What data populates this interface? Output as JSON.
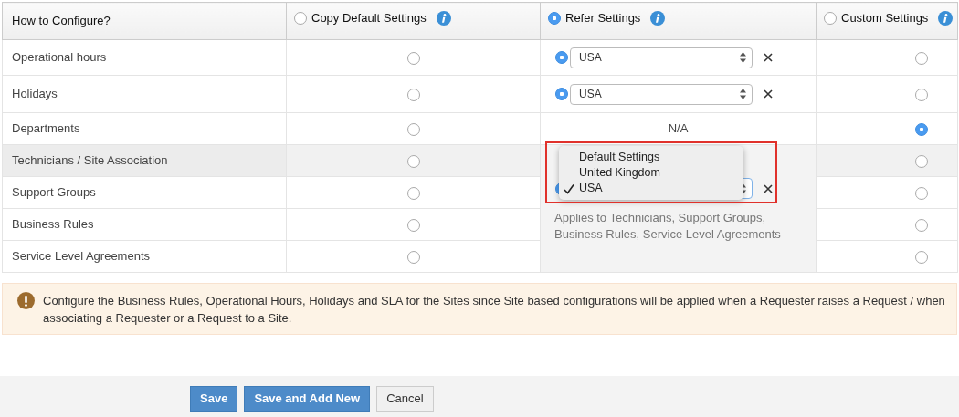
{
  "header": {
    "title": "How to Configure?",
    "columns": [
      {
        "label": "Copy Default Settings",
        "selected": false
      },
      {
        "label": "Refer Settings",
        "selected": true
      },
      {
        "label": "Custom Settings",
        "selected": false
      }
    ]
  },
  "rows": [
    {
      "label": "Operational hours",
      "highlighted": false,
      "copy_selected": false,
      "refer": {
        "kind": "select",
        "selected": true,
        "value": "USA"
      },
      "custom_selected": false
    },
    {
      "label": "Holidays",
      "highlighted": false,
      "copy_selected": false,
      "refer": {
        "kind": "select",
        "selected": true,
        "value": "USA"
      },
      "custom_selected": false
    },
    {
      "label": "Departments",
      "highlighted": false,
      "copy_selected": false,
      "refer": {
        "kind": "text",
        "text": "N/A"
      },
      "custom_selected": true
    },
    {
      "label": "Technicians / Site Association",
      "highlighted": true,
      "copy_selected": false,
      "custom_selected": false
    },
    {
      "label": "Support Groups",
      "highlighted": false,
      "copy_selected": false,
      "custom_selected": false
    },
    {
      "label": "Business Rules",
      "highlighted": false,
      "copy_selected": false,
      "custom_selected": false
    },
    {
      "label": "Service Level Agreements",
      "highlighted": false,
      "copy_selected": false,
      "custom_selected": false
    }
  ],
  "refer_group": {
    "selected": true,
    "menu": [
      {
        "label": "Default Settings",
        "selected": false
      },
      {
        "label": "United Kingdom",
        "selected": false
      },
      {
        "label": "USA",
        "selected": true
      }
    ],
    "note": "Applies to Technicians, Support Groups, Business Rules, Service Level Agreements"
  },
  "alert": "Configure the Business Rules, Operational Hours, Holidays and SLA for the Sites since Site based configurations will be applied when a Requester raises a Request / when associating a Requester or a Request to a Site.",
  "buttons": [
    {
      "label": "Save",
      "kind": "primary"
    },
    {
      "label": "Save and Add New",
      "kind": "primary"
    },
    {
      "label": "Cancel",
      "kind": "secondary"
    }
  ]
}
